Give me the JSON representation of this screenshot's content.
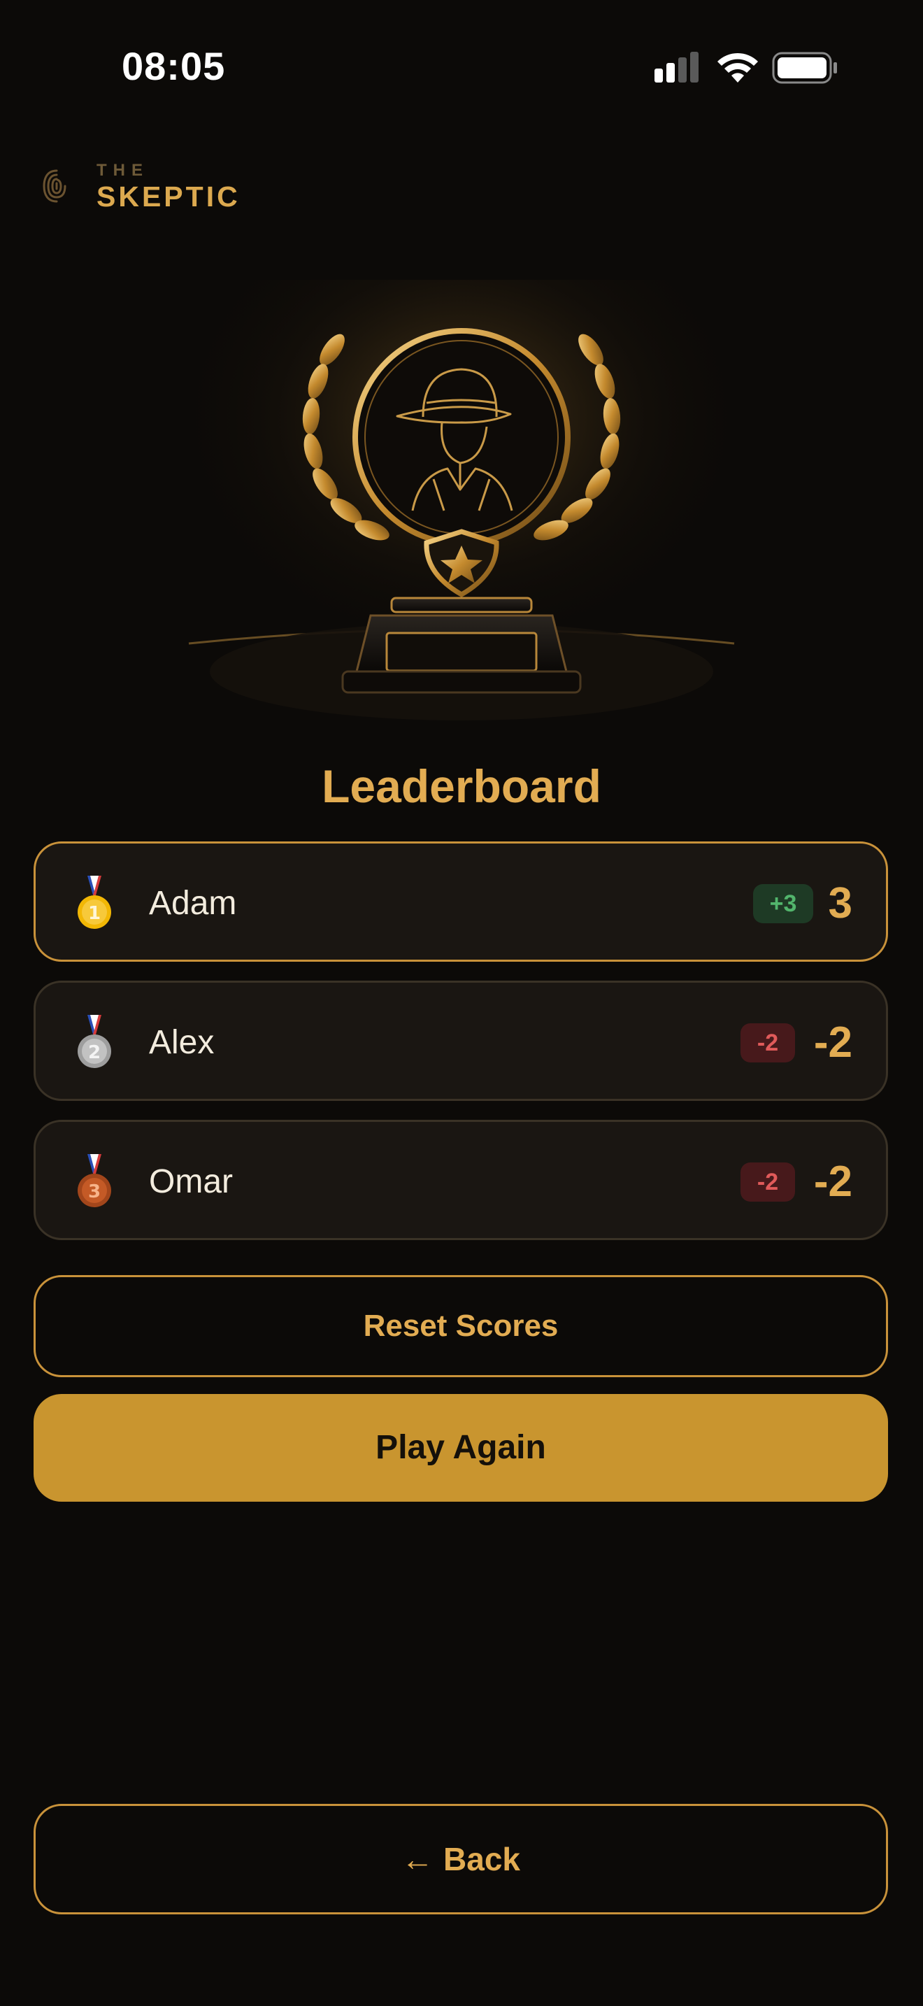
{
  "status_bar": {
    "time": "08:05",
    "signal_icon": "cellular-signal-icon",
    "wifi_icon": "wifi-icon",
    "battery_icon": "battery-icon"
  },
  "brand": {
    "prefix": "THE",
    "name": "SKEPTIC",
    "icon": "fingerprint-icon"
  },
  "hero": {
    "icon": "detective-trophy-illustration"
  },
  "leaderboard": {
    "title": "Leaderboard",
    "players": [
      {
        "rank": 1,
        "medal_icon": "gold-medal-icon",
        "medal_digit": "1",
        "name": "Adam",
        "delta": "+3",
        "delta_kind": "positive",
        "score": "3"
      },
      {
        "rank": 2,
        "medal_icon": "silver-medal-icon",
        "medal_digit": "2",
        "name": "Alex",
        "delta": "-2",
        "delta_kind": "negative",
        "score": "-2"
      },
      {
        "rank": 3,
        "medal_icon": "bronze-medal-icon",
        "medal_digit": "3",
        "name": "Omar",
        "delta": "-2",
        "delta_kind": "negative",
        "score": "-2"
      }
    ]
  },
  "actions": {
    "reset_label": "Reset Scores",
    "play_again_label": "Play Again",
    "back_arrow": "←",
    "back_label": "Back"
  },
  "colors": {
    "background": "#0c0a08",
    "accent_gold": "#e2ac52",
    "button_gold": "#c9952f",
    "positive": "#52b56c",
    "negative": "#e05a5a"
  }
}
